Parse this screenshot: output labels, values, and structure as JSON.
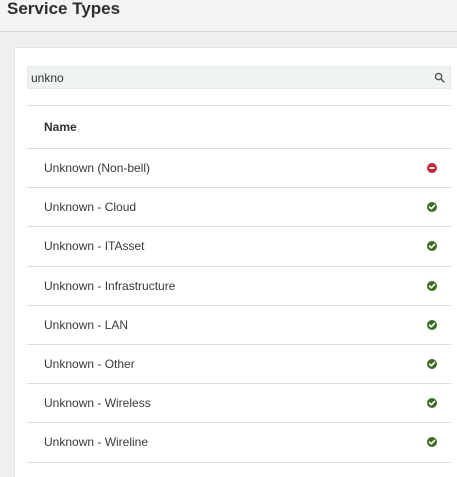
{
  "page": {
    "title": "Service Types"
  },
  "search": {
    "value": "unkno"
  },
  "table": {
    "columns": [
      "Name"
    ],
    "rows": [
      {
        "name": "Unknown (Non-bell)",
        "status": "inactive",
        "status_icon": "minus-circle-icon",
        "color": "#c8243d"
      },
      {
        "name": "Unknown - Cloud",
        "status": "active",
        "status_icon": "check-circle-icon",
        "color": "#3e6b22"
      },
      {
        "name": "Unknown - ITAsset",
        "status": "active",
        "status_icon": "check-circle-icon",
        "color": "#3e6b22"
      },
      {
        "name": "Unknown - Infrastructure",
        "status": "active",
        "status_icon": "check-circle-icon",
        "color": "#3e6b22"
      },
      {
        "name": "Unknown - LAN",
        "status": "active",
        "status_icon": "check-circle-icon",
        "color": "#3e6b22"
      },
      {
        "name": "Unknown - Other",
        "status": "active",
        "status_icon": "check-circle-icon",
        "color": "#3e6b22"
      },
      {
        "name": "Unknown - Wireless",
        "status": "active",
        "status_icon": "check-circle-icon",
        "color": "#3e6b22"
      },
      {
        "name": "Unknown - Wireline",
        "status": "active",
        "status_icon": "check-circle-icon",
        "color": "#3e6b22"
      }
    ]
  }
}
